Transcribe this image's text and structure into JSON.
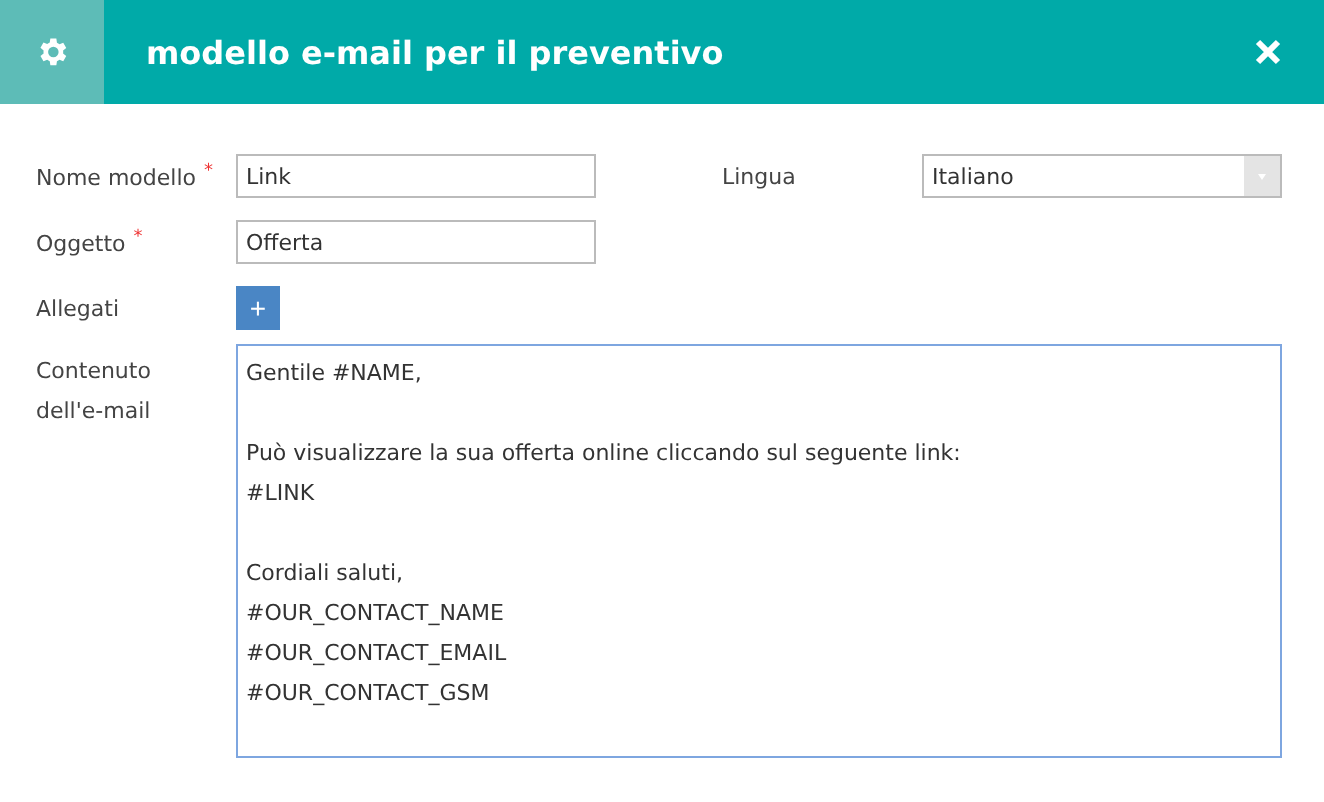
{
  "header": {
    "title": "modello e-mail per il preventivo"
  },
  "fields": [
    {
      "label": "Nome modello",
      "required_mark": "*",
      "kind": "text",
      "value": "Link"
    },
    {
      "label": "Lingua",
      "kind": "select",
      "value": "Italiano"
    },
    {
      "label": "Oggetto",
      "required_mark": "*",
      "kind": "text",
      "value": "Offerta"
    },
    {
      "label": "Allegati",
      "kind": "add",
      "button": "+"
    }
  ],
  "content": {
    "label": "Contenuto dell'e-mail",
    "paragraphs": [
      [
        "Gentile #NAME,"
      ],
      [
        "Può visualizzare la sua offerta online cliccando sul seguente link:",
        "#LINK"
      ],
      [
        "Cordiali saluti,",
        "#OUR_CONTACT_NAME",
        "#OUR_CONTACT_EMAIL",
        "#OUR_CONTACT_GSM"
      ]
    ]
  }
}
